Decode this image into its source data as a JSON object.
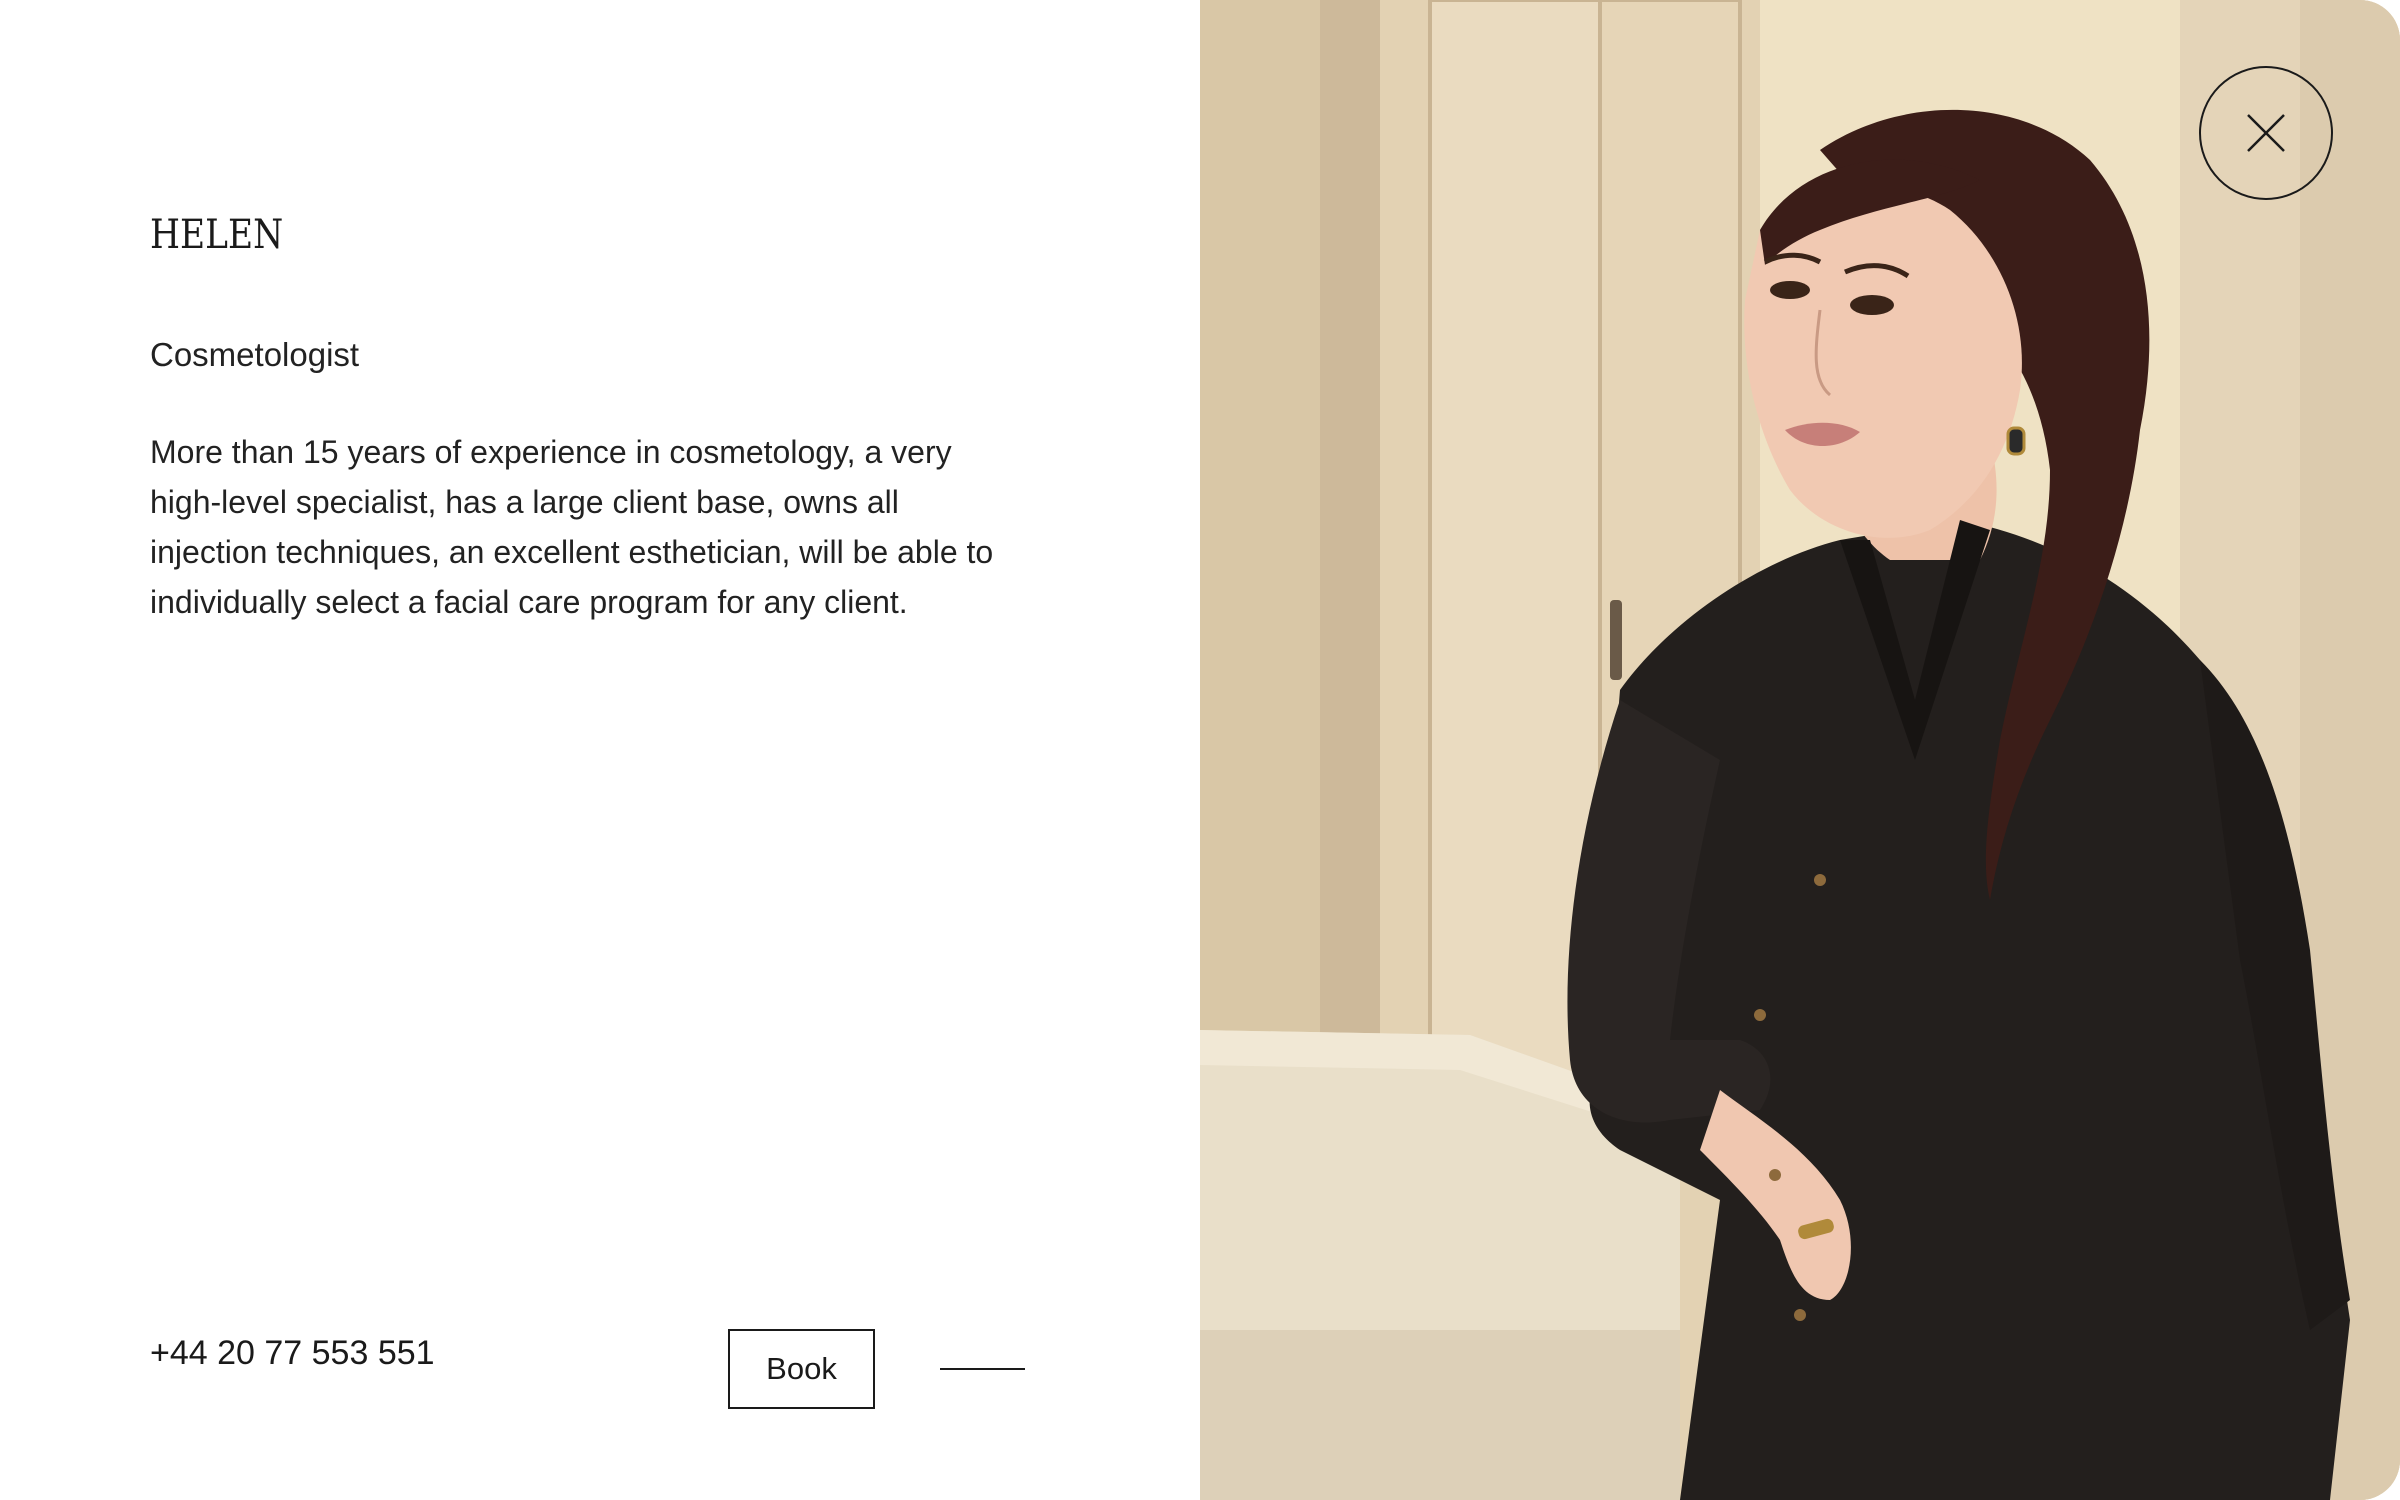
{
  "specialist": {
    "name": "HELEN",
    "role": "Cosmetologist",
    "bio": "More than 15 years of experience in cosmetology, a very high-level specialist, has a large client base, owns all injection techniques, an excellent esthetician, will be able to individually select a facial care program for any client."
  },
  "contact": {
    "phone": "+44 20 77 553 551"
  },
  "actions": {
    "book_label": "Book"
  },
  "icons": {
    "close": "close-icon"
  },
  "photo": {
    "subject": "specialist-portrait"
  }
}
